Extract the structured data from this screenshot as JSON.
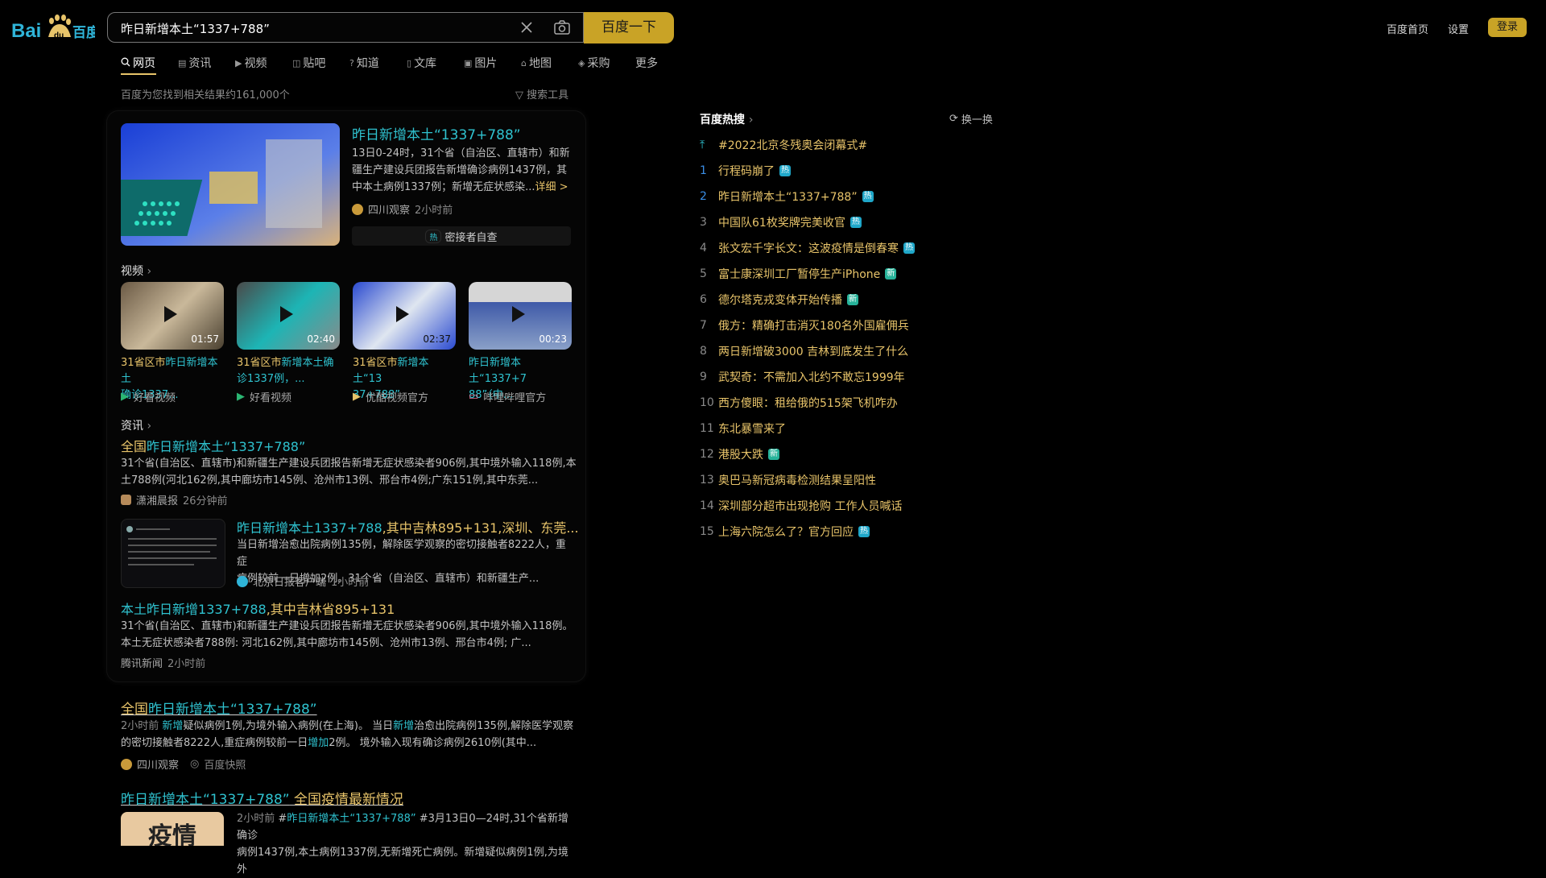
{
  "header": {
    "search_value": "昨日新增本土“1337+788”",
    "search_button": "百度一下",
    "home_link": "百度首页",
    "settings_link": "设置",
    "login_button": "登录",
    "accent_color": "#c9a326"
  },
  "tabs": [
    {
      "label": "网页",
      "icon": "search-icon",
      "active": true
    },
    {
      "label": "资讯",
      "icon": "news-icon"
    },
    {
      "label": "视频",
      "icon": "video-icon"
    },
    {
      "label": "贴吧",
      "icon": "tieba-icon"
    },
    {
      "label": "知道",
      "icon": "question-icon"
    },
    {
      "label": "文库",
      "icon": "doc-icon"
    },
    {
      "label": "图片",
      "icon": "image-icon"
    },
    {
      "label": "地图",
      "icon": "map-icon"
    },
    {
      "label": "采购",
      "icon": "bag-icon"
    },
    {
      "label": "更多"
    }
  ],
  "result_count": "百度为您找到相关结果约161,000个",
  "search_tools": "搜索工具",
  "top_result": {
    "title": "昨日新增本土“1337+788”",
    "desc": "13日0-24时，31个省（自治区、直辖市）和新疆生产建设兵团报告新增确诊病例1437例，其中本土病例1337例；新增无症状感染...",
    "detail_link": "详细 >",
    "source": "四川观察",
    "time": "2小时前",
    "related_tag": "热",
    "related_text": "密接者自查"
  },
  "videos_section": {
    "title": "视频",
    "items": [
      {
        "duration": "01:57",
        "title_a": "31省区市",
        "title_b": "昨日新增本土",
        "title_c": "确诊1337...",
        "source": "好看视频"
      },
      {
        "duration": "02:40",
        "title_a": "31省区市",
        "title_b": "新增本土确",
        "title_c": "诊1337例，...",
        "source": "好看视频"
      },
      {
        "duration": "02:37",
        "title_a": "31省区市",
        "title_b": "新增本土“13",
        "title_c": "37+788”",
        "source": "优酷视频官方"
      },
      {
        "duration": "00:23",
        "title_a": "",
        "title_b": "昨日新增本土“1337+7",
        "title_c": "88”（中...",
        "source": "哔哩哔哩官方"
      }
    ]
  },
  "news_section": {
    "title": "资讯",
    "item1": {
      "title_a": "全国",
      "title_b": "昨日新增本土“1337+788”",
      "desc1": "31个省(自治区、直辖市)和新疆生产建设兵团报告新增无症状感染者906例,其中境外输入118例,本",
      "desc2": "土788例(河北162例,其中廊坊市145例、沧州市13例、邢台市4例;广东151例,其中东莞...",
      "source": "潇湘晨报",
      "time": "26分钟前"
    },
    "item2": {
      "title_a": "昨日新增本土1337+788",
      "title_b": ",其中吉林895+131,深圳、东莞...",
      "desc1": "当日新增治愈出院病例135例，解除医学观察的密切接触者8222人，重症",
      "desc2": "病例较前一日增加2例。31个省（自治区、直辖市）和新疆生产...",
      "source": "北京日报客户端",
      "time": "1小时前"
    },
    "item3": {
      "title_a": "本土",
      "title_b": "昨日新增1337+788",
      "title_c": ",其中吉林省895+131",
      "desc1": "31个省(自治区、直辖市)和新疆生产建设兵团报告新增无症状感染者906例,其中境外输入118例。",
      "desc2": "本土无症状感染者788例: 河北162例,其中廊坊市145例、沧州市13例、邢台市4例; 广...",
      "source": "腾讯新闻",
      "time": "2小时前"
    }
  },
  "result2": {
    "title_a": "全国",
    "title_b": "昨日新增本土“1337+788”",
    "time": "2小时前",
    "desc1_a": "新增",
    "desc1_b": "疑似病例1例,为境外输入病例(在上海)。 当日",
    "desc1_c": "新增",
    "desc1_d": "治愈出院病例135例,解除医学观察",
    "desc2_a": "的密切接触者8222人,重症病例较前一日",
    "desc2_b": "增加",
    "desc2_c": "2例。 境外输入现有确诊病例2610例(其中...",
    "source": "四川观察",
    "snapshot": "百度快照"
  },
  "result3": {
    "title_a": "昨日新增本土“1337+788”",
    "title_b": " 全国疫情最新情况",
    "thumb_text": "疫情",
    "time": "2小时前",
    "desc1_a": "#",
    "desc1_b": "昨日新增本土“1337+788”",
    "desc1_c": " #3月13日0—24时,31个省新增确诊",
    "desc2": "病例1437例,本土病例1337例,无新增死亡病例。新增疑似病例1例,为境外"
  },
  "hot_search": {
    "title": "百度热搜",
    "refresh": "换一换",
    "pinned": "#2022北京冬残奥会闭幕式#",
    "items": [
      {
        "num": "1",
        "title": "行程码崩了",
        "tag": "热"
      },
      {
        "num": "2",
        "title": "昨日新增本土“1337+788”",
        "tag": "热"
      },
      {
        "num": "3",
        "title": "中国队61枚奖牌完美收官",
        "tag": "热"
      },
      {
        "num": "4",
        "title": "张文宏千字长文：这波疫情是倒春寒",
        "tag": "热"
      },
      {
        "num": "5",
        "title": "富士康深圳工厂暂停生产iPhone",
        "tag": "新"
      },
      {
        "num": "6",
        "title": "德尔塔克戎变体开始传播",
        "tag": "新"
      },
      {
        "num": "7",
        "title": "俄方：精确打击消灭180名外国雇佣兵",
        "tag": ""
      },
      {
        "num": "8",
        "title": "两日新增破3000 吉林到底发生了什么",
        "tag": ""
      },
      {
        "num": "9",
        "title": "武契奇：不需加入北约不敢忘1999年",
        "tag": ""
      },
      {
        "num": "10",
        "title": "西方傻眼：租给俄的515架飞机咋办",
        "tag": ""
      },
      {
        "num": "11",
        "title": "东北暴雪来了",
        "tag": ""
      },
      {
        "num": "12",
        "title": "港股大跌",
        "tag": "新"
      },
      {
        "num": "13",
        "title": "奥巴马新冠病毒检测结果呈阳性",
        "tag": ""
      },
      {
        "num": "14",
        "title": "深圳部分超市出现抢购 工作人员喊话",
        "tag": ""
      },
      {
        "num": "15",
        "title": "上海六院怎么了？官方回应",
        "tag": "热"
      }
    ]
  }
}
